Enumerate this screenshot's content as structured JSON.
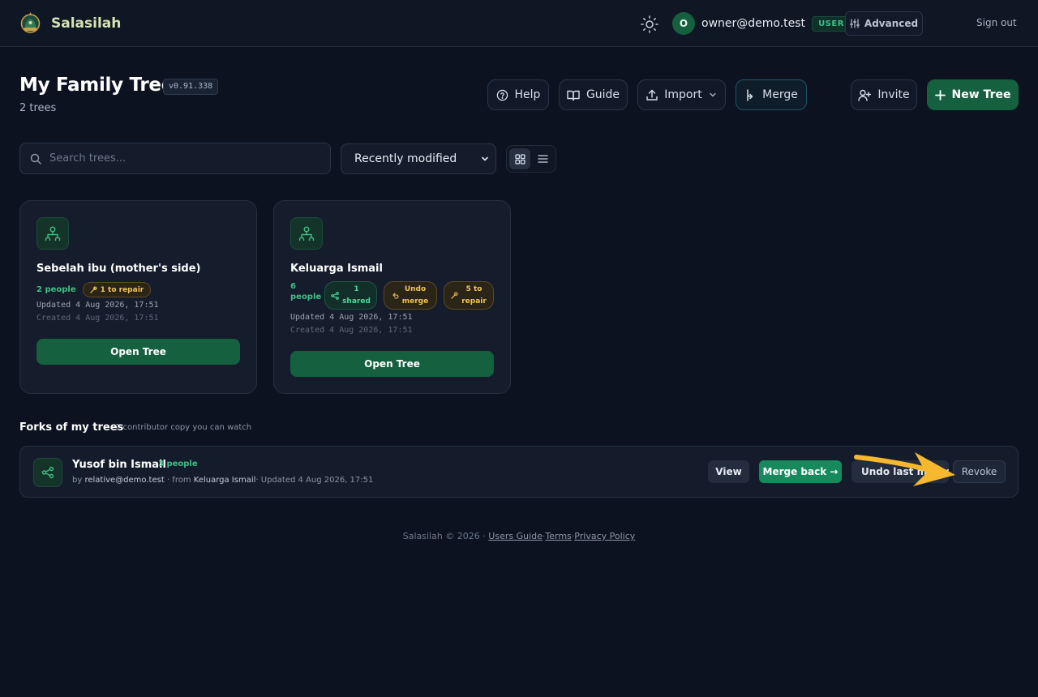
{
  "brand": {
    "name": "Salasilah",
    "logo_icon": "mosque-logo-icon"
  },
  "user": {
    "avatar_initial": "O",
    "email": "owner@demo.test",
    "role": "USER"
  },
  "topbar": {
    "advanced_label": "Advanced",
    "signout_label": "Sign out"
  },
  "header": {
    "title": "My Family Trees",
    "version": "v0.91.338",
    "count": "2 trees",
    "help_label": "Help",
    "guide_label": "Guide",
    "import_label": "Import",
    "merge_label": "Merge",
    "invite_label": "Invite",
    "new_tree_label": "New Tree"
  },
  "filters": {
    "search_placeholder": "Search trees...",
    "sort_value": "Recently modified",
    "view_mode": "grid"
  },
  "trees": [
    {
      "title": "Sebelah ibu (mother's side)",
      "people": "2 people",
      "chips": [
        "1 to repair"
      ],
      "updated": "Updated 4 Aug 2026, 17:51",
      "created": "Created 4 Aug 2026, 17:51",
      "open_label": "Open Tree"
    },
    {
      "title": "Keluarga Ismail",
      "people_num": "6",
      "people_word": "people",
      "shared_chip": [
        "1",
        "shared"
      ],
      "undo_chip": [
        "Undo",
        "merge"
      ],
      "repair_chip": [
        "5 to",
        "repair"
      ],
      "updated": "Updated 4 Aug 2026, 17:51",
      "created": "Created 4 Aug 2026, 17:51",
      "open_label": "Open Tree"
    }
  ],
  "forks": {
    "title": "Forks of my trees",
    "subtitle": "1 contributor copy you can watch",
    "items": [
      {
        "name": "Yusof bin Ismail",
        "people": "3 people",
        "by_prefix": "by",
        "by_user": "relative@demo.test",
        "from_prefix": "· from",
        "from_tree": "Keluarga Ismail",
        "updated": "· Updated 4 Aug 2026, 17:51",
        "view_label": "View",
        "merge_back_label": "Merge back →",
        "undo_label": "Undo last merge",
        "revoke_label": "Revoke"
      }
    ]
  },
  "footer": {
    "copyright": "Salasilah © 2026 ·",
    "users_guide": "Users Guide",
    "sep": "·",
    "terms": "Terms",
    "privacy": "Privacy Policy"
  },
  "colors": {
    "accent": "#15603f",
    "accent_bright": "#3fbf86",
    "warning": "#f0c25a",
    "annotation_arrow": "#f5b82e",
    "background": "#0c1220"
  }
}
